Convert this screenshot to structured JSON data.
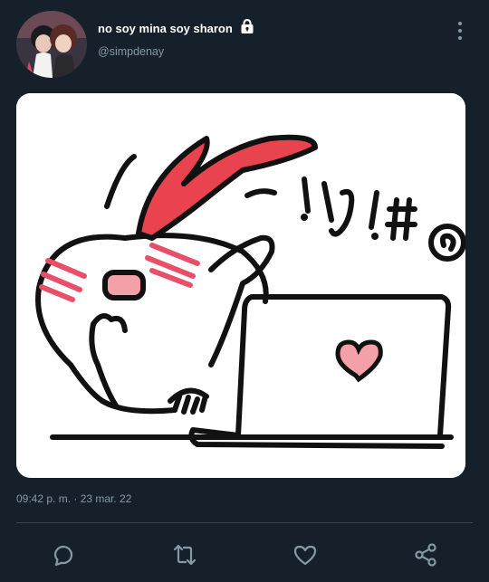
{
  "user": {
    "display_name": "no soy mina soy sharon",
    "handle": "@simpdenay",
    "protected_icon": "lock-icon",
    "avatar_icon": "profile-photo"
  },
  "tweet": {
    "media_icon": "blushing-cartoon-at-laptop",
    "media_text": {
      "symbols": "·!:$!#@",
      "heart": "♥"
    },
    "timestamp": "09:42 p. m. · 23 mar. 22"
  },
  "menu": {
    "icon": "more-vertical-icon"
  },
  "actions": [
    {
      "name": "reply",
      "icon": "comment-icon"
    },
    {
      "name": "retweet",
      "icon": "retweet-icon"
    },
    {
      "name": "like",
      "icon": "heart-icon"
    },
    {
      "name": "share",
      "icon": "share-icon"
    }
  ],
  "colors": {
    "background": "#15202b",
    "text_primary": "#ffffff",
    "text_secondary": "#8899a6",
    "divider": "#38444d",
    "action_icons": "#8899a6",
    "blush": "#e8506a"
  }
}
